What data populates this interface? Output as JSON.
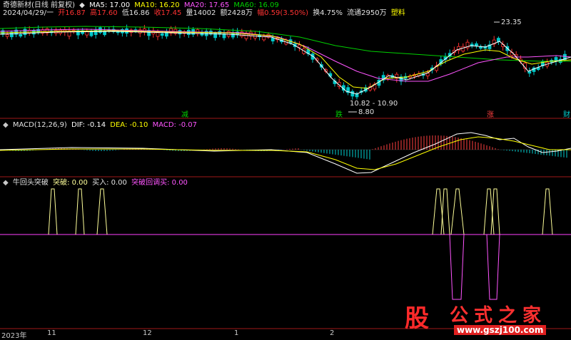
{
  "header": {
    "title": "奇德新材(日线 前复权)",
    "ma5": "MA5: 17.00",
    "ma10": "MA10: 16.20",
    "ma20": "MA20: 17.65",
    "ma60": "MA60: 16.09",
    "date": "2024/04/29/一",
    "open": "开16.87",
    "high": "高17.60",
    "low": "低16.86",
    "close": "收17.45",
    "volume": "量14002",
    "amount": "额2428万",
    "change": "幅0.59(3.50%)",
    "turnover": "换4.75%",
    "float": "流通2950万",
    "sector": "塑料"
  },
  "colors": {
    "ma5": "#ffffff",
    "ma10": "#ffff00",
    "ma20": "#ff55ff",
    "ma60": "#00d000",
    "up": "#ff3232",
    "down": "#00c8c8",
    "axis": "#a01818"
  },
  "annotations": {
    "high_label": "23.35",
    "low_label": "8.80",
    "range_label": "10.82 - 10.90",
    "markers": [
      {
        "text": "减",
        "color": "#00d000"
      },
      {
        "text": "跌",
        "color": "#00d000"
      },
      {
        "text": "涨",
        "color": "#ff4040"
      },
      {
        "text": "财",
        "color": "#00d0d0"
      }
    ]
  },
  "macd": {
    "title": "MACD(12,26,9)",
    "dif": "DIF: -0.14",
    "dea": "DEA: -0.10",
    "macd": "MACD: -0.07"
  },
  "indicator": {
    "name": "牛回头突破",
    "breakout": "突破: 0.00",
    "buy": "买入: 0.00",
    "pullback": "突破回调买: 0.00"
  },
  "xaxis": [
    "2023年",
    "11",
    "12",
    "1",
    "2"
  ],
  "watermark": {
    "logo": "股",
    "title": "公式之家",
    "url": "www.gszj100.com"
  }
}
